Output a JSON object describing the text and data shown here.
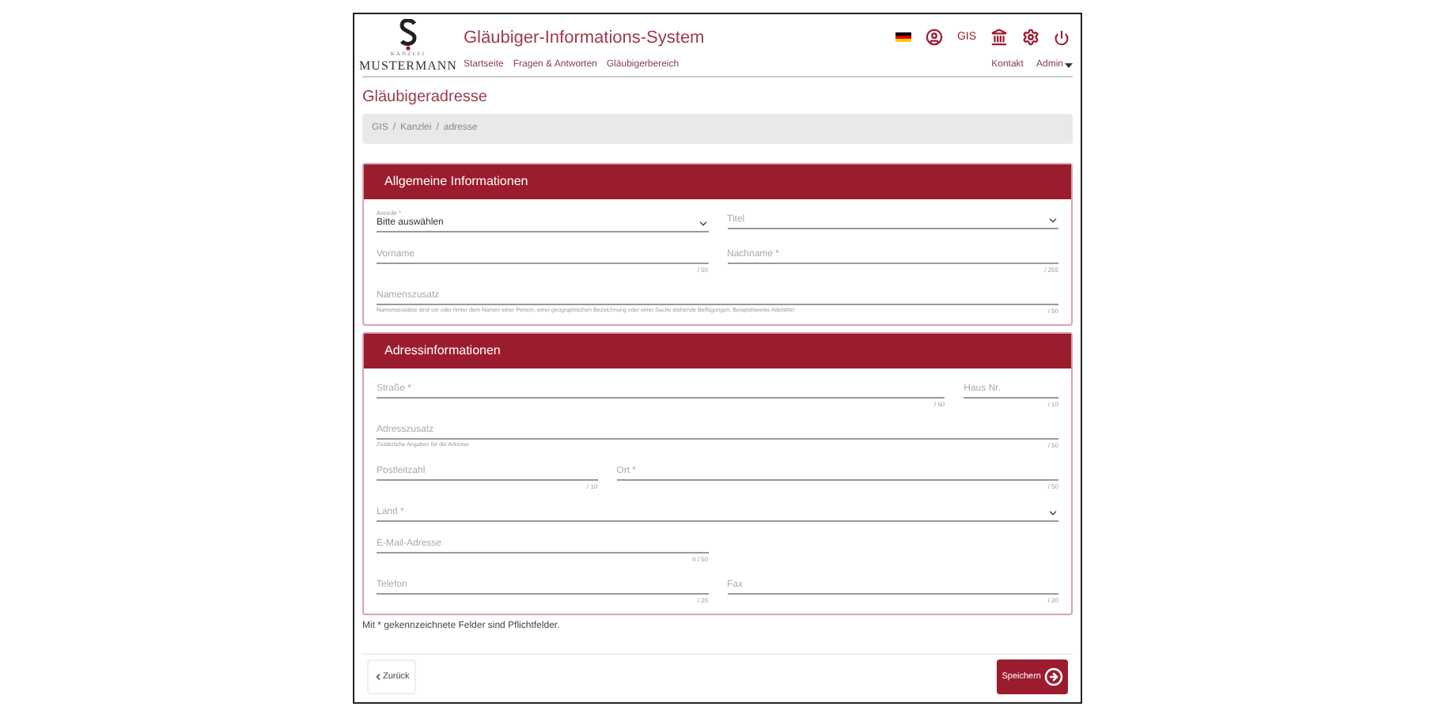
{
  "logo": {
    "small": "KANZLEI",
    "name": "MUSTERMANN"
  },
  "app_title": "Gläubiger-Informations-System",
  "nav": [
    "Startseite",
    "Fragen & Antworten",
    "Gläubigerbereich"
  ],
  "header_icons": [
    {
      "kind": "flag"
    },
    {
      "kind": "user"
    },
    {
      "kind": "text",
      "text": "GIS"
    },
    {
      "kind": "bank"
    },
    {
      "kind": "gear"
    },
    {
      "kind": "power"
    }
  ],
  "header_links": [
    {
      "label": "Kontakt",
      "dropdown": false
    },
    {
      "label": "Admin",
      "dropdown": true
    }
  ],
  "page_title": "Gläubigeradresse",
  "breadcrumb": [
    "GIS",
    "/",
    "Kanzlei",
    "/",
    "adresse"
  ],
  "sections": [
    {
      "title": "Allgemeine Informationen",
      "rows": [
        [
          {
            "kind": "select",
            "label": "Anrede *",
            "value": "Bitte auswählen"
          },
          {
            "kind": "select",
            "label": "Titel"
          }
        ],
        [
          {
            "kind": "text",
            "label": "Vorname",
            "counter": "/ 50"
          },
          {
            "kind": "text",
            "label": "Nachname *",
            "counter": "/ 255"
          }
        ],
        [
          {
            "kind": "text",
            "label": "Namenszusatz",
            "hint": "Namenszusätze sind vor oder hinter dem Namen einer Person, einer geographischen Bezeichnung oder einer Sache stehende Beifügungen. Beispielsweise Adelstitel",
            "counter": "/ 50"
          }
        ]
      ]
    },
    {
      "title": "Adressinformationen",
      "rows": [
        [
          {
            "kind": "text",
            "label": "Straße *",
            "counter": "/ 50"
          },
          {
            "kind": "text",
            "label": "Haus Nr.",
            "counter": "/ 10"
          }
        ],
        [
          {
            "kind": "text",
            "label": "Adresszusatz",
            "hint": "Zusätzliche Angaben für die Adresse",
            "counter": "/ 50"
          }
        ],
        [
          {
            "kind": "text",
            "label": "Postleitzahl",
            "counter": "/ 10"
          },
          {
            "kind": "text",
            "label": "Ort *",
            "counter": "/ 50"
          }
        ],
        [
          {
            "kind": "select",
            "label": "Land *"
          }
        ],
        [
          {
            "kind": "text",
            "label": "E-Mail-Adresse",
            "counter": "0 / 50"
          }
        ],
        [
          {
            "kind": "text",
            "label": "Telefon",
            "counter": "/ 20"
          },
          {
            "kind": "text",
            "label": "Fax",
            "counter": "/ 20"
          }
        ]
      ]
    }
  ],
  "note": "Mit * gekennzeichnete Felder sind Pflichtfelder.",
  "back_button": "Zurück",
  "save_button": "Speichern"
}
